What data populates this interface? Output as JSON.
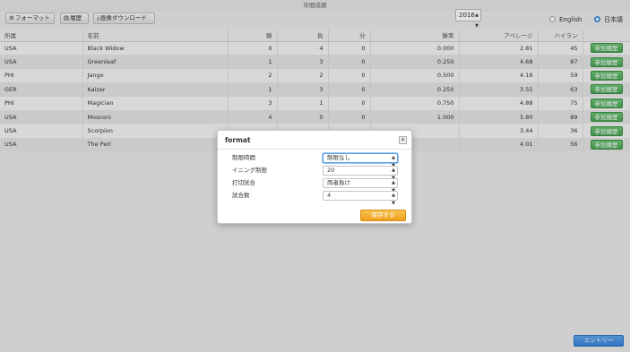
{
  "window": {
    "title": "年間成績"
  },
  "toolbar": {
    "format_label": "フォーマット",
    "history_label": "履歴",
    "download_label": "画像ダウンロード"
  },
  "year": {
    "selected": "2016"
  },
  "language": {
    "english": "English",
    "japanese": "日本語",
    "selected": "日本語"
  },
  "table": {
    "columns": [
      "所属",
      "名前",
      "勝",
      "負",
      "分",
      "勝率",
      "アベレージ",
      "ハイラン",
      ""
    ],
    "rows": [
      {
        "team": "USA",
        "name": "Black Widow",
        "win": "0",
        "loss": "4",
        "draw": "0",
        "rate": "0.000",
        "avg": "2.81",
        "high": "45",
        "btn": "参加履歴"
      },
      {
        "team": "USA",
        "name": "Greenleaf",
        "win": "1",
        "loss": "3",
        "draw": "0",
        "rate": "0.250",
        "avg": "4.68",
        "high": "87",
        "btn": "参加履歴"
      },
      {
        "team": "PHI",
        "name": "Jango",
        "win": "2",
        "loss": "2",
        "draw": "0",
        "rate": "0.500",
        "avg": "4.19",
        "high": "59",
        "btn": "参加履歴"
      },
      {
        "team": "GER",
        "name": "Kaizer",
        "win": "1",
        "loss": "3",
        "draw": "0",
        "rate": "0.250",
        "avg": "3.55",
        "high": "63",
        "btn": "参加履歴"
      },
      {
        "team": "PHI",
        "name": "Magician",
        "win": "3",
        "loss": "1",
        "draw": "0",
        "rate": "0.750",
        "avg": "4.88",
        "high": "75",
        "btn": "参加履歴"
      },
      {
        "team": "USA",
        "name": "Mosconi",
        "win": "4",
        "loss": "0",
        "draw": "0",
        "rate": "1.000",
        "avg": "5.80",
        "high": "89",
        "btn": "参加履歴"
      },
      {
        "team": "USA",
        "name": "Scorpion",
        "win": "",
        "loss": "",
        "draw": "",
        "rate": "",
        "avg": "3.44",
        "high": "36",
        "btn": "参加履歴"
      },
      {
        "team": "USA",
        "name": "The Perl",
        "win": "",
        "loss": "",
        "draw": "",
        "rate": "",
        "avg": "4.01",
        "high": "56",
        "btn": "参加履歴"
      }
    ]
  },
  "dialog": {
    "title": "format",
    "close_glyph": "×",
    "fields": [
      {
        "label": "制限時間",
        "value": "制限なし"
      },
      {
        "label": "イニング制限",
        "value": "20"
      },
      {
        "label": "打切試合",
        "value": "両者負け"
      },
      {
        "label": "試合数",
        "value": "4"
      }
    ],
    "save_label": "保存する"
  },
  "footer": {
    "entry_label": "エントリー"
  },
  "colors": {
    "accent": "#3b86dd",
    "history_button": "#4aa556",
    "save_button": "#ef9f1e"
  },
  "icons": {
    "format": "gear-icon",
    "history": "printer-icon",
    "download": "download-icon",
    "close": "close-icon"
  }
}
